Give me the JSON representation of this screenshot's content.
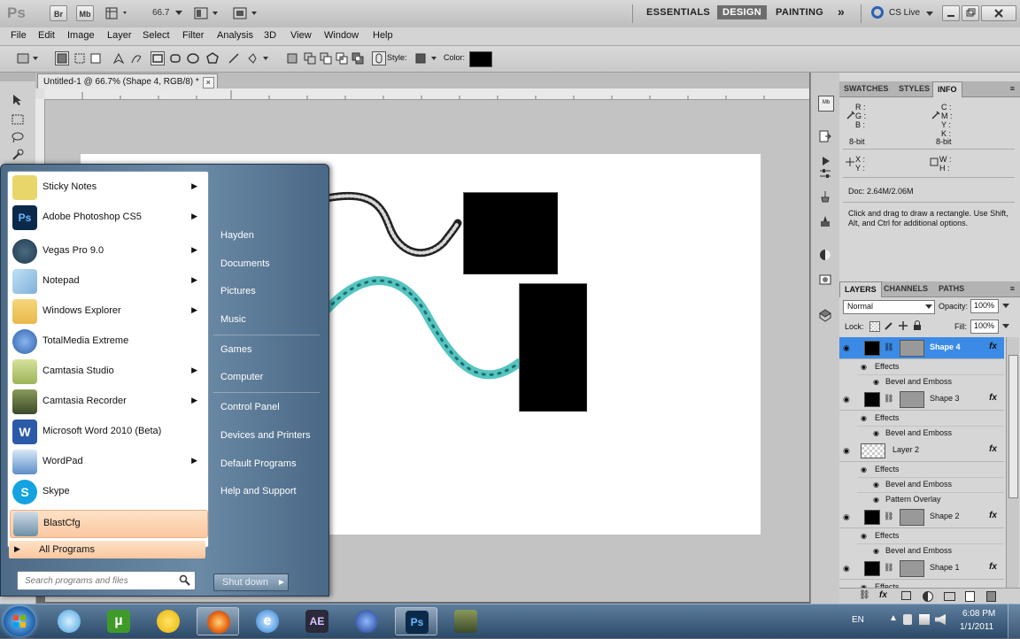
{
  "appbar": {
    "logo": "Ps",
    "bridge": "Br",
    "minibridge": "Mb",
    "zoom": "66.7",
    "workspaces": [
      "ESSENTIALS",
      "DESIGN",
      "PAINTING"
    ],
    "more": "»",
    "cslive": "CS Live"
  },
  "menubar": [
    "File",
    "Edit",
    "Image",
    "Layer",
    "Select",
    "Filter",
    "Analysis",
    "3D",
    "View",
    "Window",
    "Help"
  ],
  "optbar": {
    "style_label": "Style:",
    "color_label": "Color:"
  },
  "document": {
    "tab_title": "Untitled-1 @ 66.7% (Shape 4, RGB/8) *",
    "close": "×"
  },
  "info_panel": {
    "tabs": [
      "SWATCHES",
      "STYLES",
      "INFO"
    ],
    "rgb": [
      "R :",
      "G :",
      "B :"
    ],
    "cmyk": [
      "C :",
      "M :",
      "Y :",
      "K :"
    ],
    "bit_left": "8-bit",
    "bit_right": "8-bit",
    "xy": [
      "X :",
      "Y :"
    ],
    "wh": [
      "W :",
      "H :"
    ],
    "doc": "Doc: 2.64M/2.06M",
    "hint": "Click and drag to draw a rectangle.  Use Shift, Alt, and Ctrl for additional options."
  },
  "layers_panel": {
    "tabs": [
      "LAYERS",
      "CHANNELS",
      "PATHS"
    ],
    "blend_mode": "Normal",
    "opacity_label": "Opacity:",
    "opacity": "100%",
    "lock_label": "Lock:",
    "fill_label": "Fill:",
    "fill": "100%",
    "fx": "fx",
    "layers": [
      {
        "name": "Shape 4",
        "effects_label": "Effects",
        "effects": [
          "Bevel and Emboss"
        ]
      },
      {
        "name": "Shape 3",
        "effects_label": "Effects",
        "effects": [
          "Bevel and Emboss"
        ]
      },
      {
        "name": "Layer 2",
        "effects_label": "Effects",
        "effects": [
          "Bevel and Emboss",
          "Pattern Overlay"
        ]
      },
      {
        "name": "Shape 2",
        "effects_label": "Effects",
        "effects": [
          "Bevel and Emboss"
        ]
      },
      {
        "name": "Shape 1",
        "effects_label": "Effects",
        "effects": []
      }
    ]
  },
  "start_menu": {
    "programs": [
      {
        "label": "Sticky Notes",
        "arrow": "▶",
        "color": "#e8d66a"
      },
      {
        "label": "Adobe Photoshop CS5",
        "arrow": "▶",
        "color": "#0b2a4a"
      },
      {
        "label": "Vegas Pro 9.0",
        "arrow": "▶",
        "color": "#1f3a4f"
      },
      {
        "label": "Notepad",
        "arrow": "▶",
        "color": "#7fb0d8"
      },
      {
        "label": "Windows Explorer",
        "arrow": "▶",
        "color": "#e7b84c"
      },
      {
        "label": "TotalMedia Extreme",
        "arrow": "",
        "color": "#2d5fa8"
      },
      {
        "label": "Camtasia Studio",
        "arrow": "▶",
        "color": "#9cb35a"
      },
      {
        "label": "Camtasia Recorder",
        "arrow": "▶",
        "color": "#5a6a3a"
      },
      {
        "label": "Microsoft Word 2010 (Beta)",
        "arrow": "",
        "color": "#2a5aa8"
      },
      {
        "label": "WordPad",
        "arrow": "▶",
        "color": "#5d8ec7"
      },
      {
        "label": "Skype",
        "arrow": "",
        "color": "#13a3e0"
      },
      {
        "label": "BlastCfg",
        "arrow": "",
        "color": "#6f8fa8"
      }
    ],
    "all_programs": "All Programs",
    "all_programs_arrow": "▶",
    "search_placeholder": "Search programs and files",
    "right_items": [
      "Hayden",
      "Documents",
      "Pictures",
      "Music",
      "Games",
      "Computer",
      "Control Panel",
      "Devices and Printers",
      "Default Programs",
      "Help and Support"
    ],
    "shutdown": "Shut down",
    "shutdown_arrow": "▶"
  },
  "taskbar": {
    "lang": "EN",
    "time": "6:08 PM",
    "date": "1/1/2011"
  }
}
